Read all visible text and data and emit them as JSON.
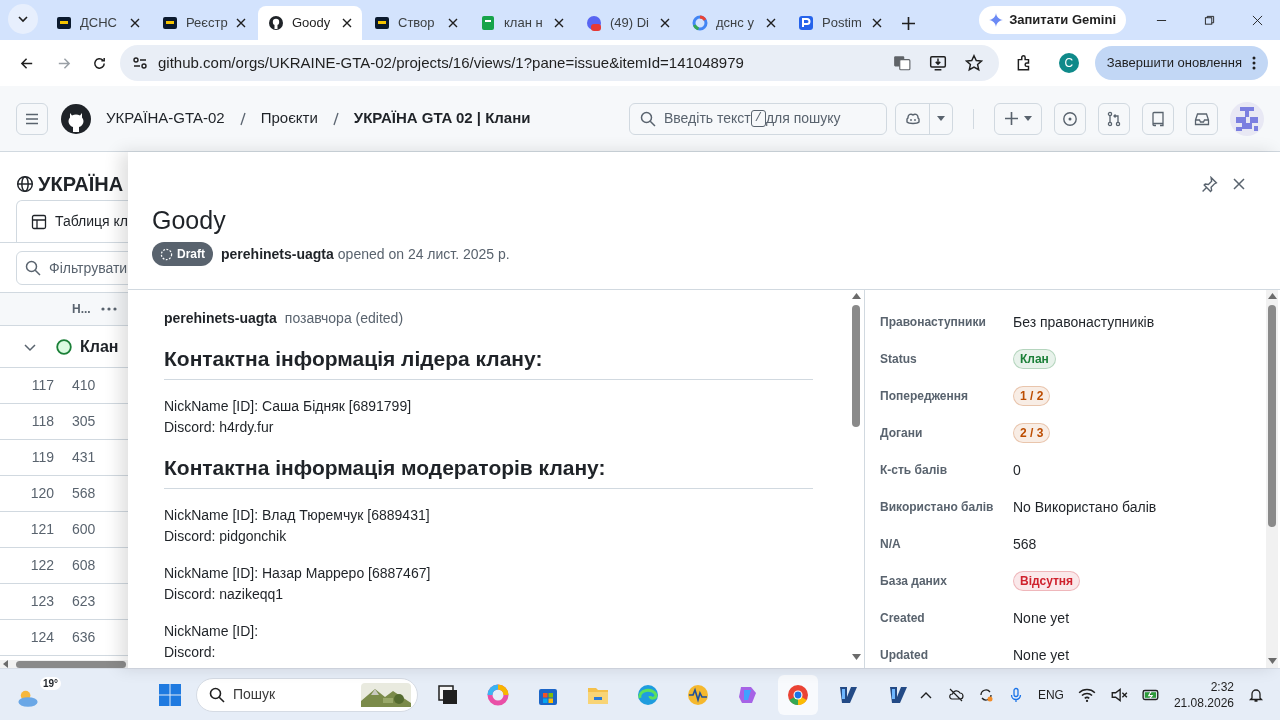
{
  "browser": {
    "tabs": [
      {
        "title": "ДСНС",
        "kind": "game",
        "selected": false
      },
      {
        "title": "Реєстр",
        "kind": "game",
        "selected": false
      },
      {
        "title": "Goody",
        "kind": "github",
        "selected": true
      },
      {
        "title": "Створ",
        "kind": "game",
        "selected": false
      },
      {
        "title": "клан н",
        "kind": "sheet",
        "selected": false
      },
      {
        "title": "(49) Di",
        "kind": "discord",
        "selected": false
      },
      {
        "title": "дснс у",
        "kind": "google",
        "selected": false
      },
      {
        "title": "Postim",
        "kind": "postimg",
        "selected": false
      }
    ],
    "gemini_button": "Запитати Gemini",
    "url": "github.com/orgs/UKRAINE-GTA-02/projects/16/views/1?pane=issue&itemId=141048979",
    "profile_initial": "C",
    "update_button": "Завершити оновлення"
  },
  "github_header": {
    "breadcrumbs": [
      "УКРАЇНА-GTA-02",
      "Проєкти",
      "УКРАЇНА GTA 02 | Клани"
    ],
    "search": {
      "before": "Введіть текст",
      "key": "/",
      "after": "для пошуку"
    }
  },
  "project": {
    "title": "УКРАЇНА",
    "view_tab": "Таблиця кл",
    "filter_placeholder": "Фільтрувати",
    "column": "Н...",
    "group": "Клан",
    "rows": [
      {
        "index": "117",
        "value": "410"
      },
      {
        "index": "118",
        "value": "305"
      },
      {
        "index": "119",
        "value": "431"
      },
      {
        "index": "120",
        "value": "568"
      },
      {
        "index": "121",
        "value": "600"
      },
      {
        "index": "122",
        "value": "608"
      },
      {
        "index": "123",
        "value": "623"
      },
      {
        "index": "124",
        "value": "636"
      }
    ]
  },
  "issue_panel": {
    "title": "Goody",
    "state": "Draft",
    "author": "perehinets-uagta",
    "opened": "opened on 24 лист. 2025 р.",
    "comment": {
      "author": "perehinets-uagta",
      "time": "позавчора (edited)",
      "body": [
        {
          "kind": "heading",
          "text": "Контактна інформація лідера клану:"
        },
        {
          "kind": "paragraph",
          "lines": [
            "NickName [ID]: Саша Бідняк [6891799]",
            "Discord: h4rdy.fur"
          ]
        },
        {
          "kind": "heading",
          "text": "Контактна інформація модераторів клану:"
        },
        {
          "kind": "paragraph",
          "lines": [
            "NickName [ID]: Влад Тюремчук [6889431]",
            "Discord: pidgonchik"
          ]
        },
        {
          "kind": "paragraph",
          "lines": [
            "NickName [ID]: Назар Марреро [6887467]",
            "Discord: nazikeqq1"
          ]
        },
        {
          "kind": "paragraph",
          "lines": [
            "NickName [ID]:",
            "Discord:"
          ]
        }
      ]
    },
    "fields": [
      {
        "label": "Правонаступники",
        "kind": "text",
        "value": "Без правонаступників"
      },
      {
        "label": "Status",
        "kind": "badge",
        "value": "Клан",
        "color": "#1a7f37"
      },
      {
        "label": "Попередження",
        "kind": "badge",
        "value": "1 / 2",
        "color": "#bc4c00"
      },
      {
        "label": "Догани",
        "kind": "badge",
        "value": "2 / 3",
        "color": "#bc4c00"
      },
      {
        "label": "К-сть балів",
        "kind": "text",
        "value": "0"
      },
      {
        "label": "Використано балів",
        "kind": "text",
        "value": "No Використано балів"
      },
      {
        "label": "N/A",
        "kind": "text",
        "value": "568"
      },
      {
        "label": "База даних",
        "kind": "badge",
        "value": "Відсутня",
        "color": "#cf222e"
      },
      {
        "label": "Created",
        "kind": "text",
        "value": "None yet"
      },
      {
        "label": "Updated",
        "kind": "text",
        "value": "None yet"
      }
    ]
  },
  "taskbar": {
    "temperature": "19°",
    "search_placeholder": "Пошук",
    "language": "ENG",
    "time": "2:32",
    "date": "21.08.2026"
  }
}
